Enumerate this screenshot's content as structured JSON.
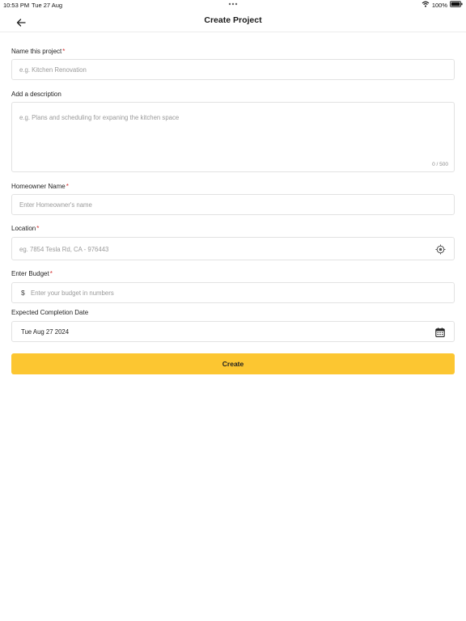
{
  "status_bar": {
    "time": "10:53 PM",
    "date": "Tue 27 Aug",
    "battery": "100%"
  },
  "header": {
    "title": "Create Project"
  },
  "form": {
    "project_name": {
      "label": "Name this project",
      "required": "*",
      "placeholder": "e.g. Kitchen Renovation"
    },
    "description": {
      "label": "Add a description",
      "placeholder": "e.g. Plans and scheduling for expaning the kitchen space",
      "counter": "0 / 500"
    },
    "homeowner": {
      "label": "Homeowner Name",
      "required": "*",
      "placeholder": "Enter Homeowner's name"
    },
    "location": {
      "label": "Location",
      "required": "*",
      "placeholder": "eg. 7854 Tesla Rd, CA - 976443",
      "icon": "crosshair-icon"
    },
    "budget": {
      "label": "Enter Budget",
      "required": "*",
      "currency": "$",
      "placeholder": "Enter your budget in numbers"
    },
    "completion_date": {
      "label": "Expected Completion Date",
      "value": "Tue Aug 27 2024",
      "icon": "calendar-icon"
    },
    "submit_label": "Create"
  },
  "colors": {
    "accent": "#fcc631",
    "required": "#d32f2f",
    "border": "#e2e2e2"
  }
}
